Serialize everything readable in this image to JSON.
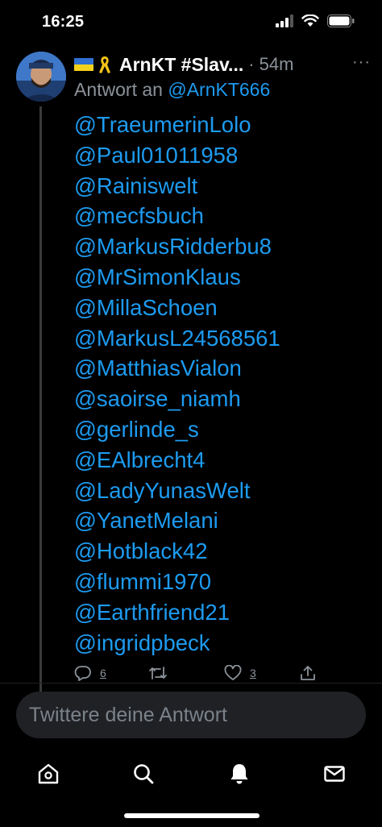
{
  "status_bar": {
    "time": "16:25"
  },
  "tweet": {
    "flags": [
      "🇺🇦",
      "🎗"
    ],
    "author_name": "ArnKT #Slav...",
    "time_meta": "· 54m",
    "more_label": "···",
    "reply_prefix": "Antwort an",
    "reply_handle": "@ArnKT666",
    "mentions": [
      "@TraeumerinLolo",
      "@Paul01011958",
      "@Rainiswelt",
      "@mecfsbuch",
      "@MarkusRidderbu8",
      "@MrSimonKlaus",
      "@MillaSchoen",
      "@MarkusL24568561",
      "@MatthiasVialon",
      "@saoirse_niamh",
      "@gerlinde_s",
      "@EAlbrecht4",
      "@LadyYunasWelt",
      "@YanetMelani",
      "@Hotblack42",
      "@flummi1970",
      "@Earthfriend21",
      "@ingridpbeck"
    ],
    "actions": {
      "reply_count": "6",
      "retweet_count": "",
      "like_count": "3"
    }
  },
  "reply_box": {
    "placeholder": "Twittere deine Antwort"
  },
  "tab_bar": {
    "items": [
      {
        "icon": "home-icon"
      },
      {
        "icon": "search-icon"
      },
      {
        "icon": "bell-icon"
      },
      {
        "icon": "mail-icon"
      }
    ]
  },
  "colors": {
    "background": "#000000",
    "accent": "#1d9bf0",
    "muted": "#8b9299"
  }
}
